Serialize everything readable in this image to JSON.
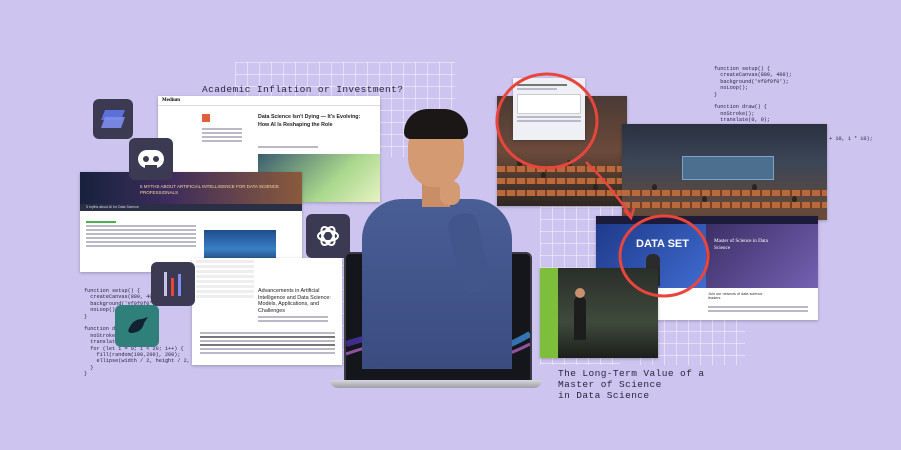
{
  "headline_top": "Academic Inflation or Investment?",
  "headline_bottom": [
    "The Long-Term Value of a",
    "Master of Science",
    "in Data Science"
  ],
  "code_snippet": [
    "function setup() {",
    "  createCanvas(800, 400);",
    "  background('#f0f0f0');",
    "  noLoop();",
    "}",
    "",
    "function draw() {",
    "  noStroke();",
    "  translate(0, 0);",
    "  for (let i = 0; i < 20; i++) {",
    "    fill(random(100,200), 200);",
    "    ellipse(width / 2, height / 2, i + 10, i * 10);",
    "  }",
    "}"
  ],
  "article_card": {
    "site": "Medium",
    "title": "Data Science Isn't Dying — It's Evolving: How AI Is Reshaping the Role"
  },
  "banner_card": {
    "title": "5 MYTHS ABOUT ARTIFICIAL INTELLIGENCE FOR DATA SCIENCE PROFESSIONALS",
    "subtitle": "5 myths about AI for Data Science"
  },
  "paper_card": {
    "title": "Advancements in Artificial Intelligence and Data Science: Models, Applications, and Challenges"
  },
  "slide_card": {
    "title": "DATA SET",
    "heading": "Master of Science in Data Science",
    "subheading": "Join our network of data science leaders"
  },
  "icons": {
    "tile1": "layers-icon",
    "tile2": "robot-icon",
    "tile3": "openai-icon",
    "tile4": "chart-bars-icon",
    "tile5": "bird-icon"
  },
  "colors": {
    "background": "#cdc4ef",
    "accent_red": "#e8453c",
    "tile_dark": "#3c3a52",
    "tile_blue": "#5d6fd8",
    "tile_teal": "#2f7f7a"
  }
}
